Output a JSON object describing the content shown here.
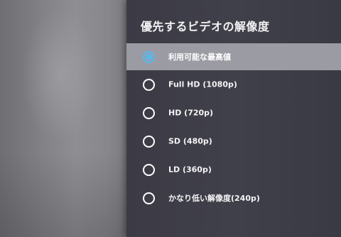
{
  "dialog": {
    "title": "優先するビデオの解像度",
    "options": [
      {
        "label": "利用可能な最高値",
        "selected": true
      },
      {
        "label": "Full HD (1080p)",
        "selected": false
      },
      {
        "label": "HD (720p)",
        "selected": false
      },
      {
        "label": "SD (480p)",
        "selected": false
      },
      {
        "label": "LD (360p)",
        "selected": false
      },
      {
        "label": "かなり低い解像度(240p)",
        "selected": false
      }
    ]
  },
  "colors": {
    "panel": "#3d3c46",
    "highlight": "#9b9ba4",
    "accent": "#58b9ec"
  }
}
